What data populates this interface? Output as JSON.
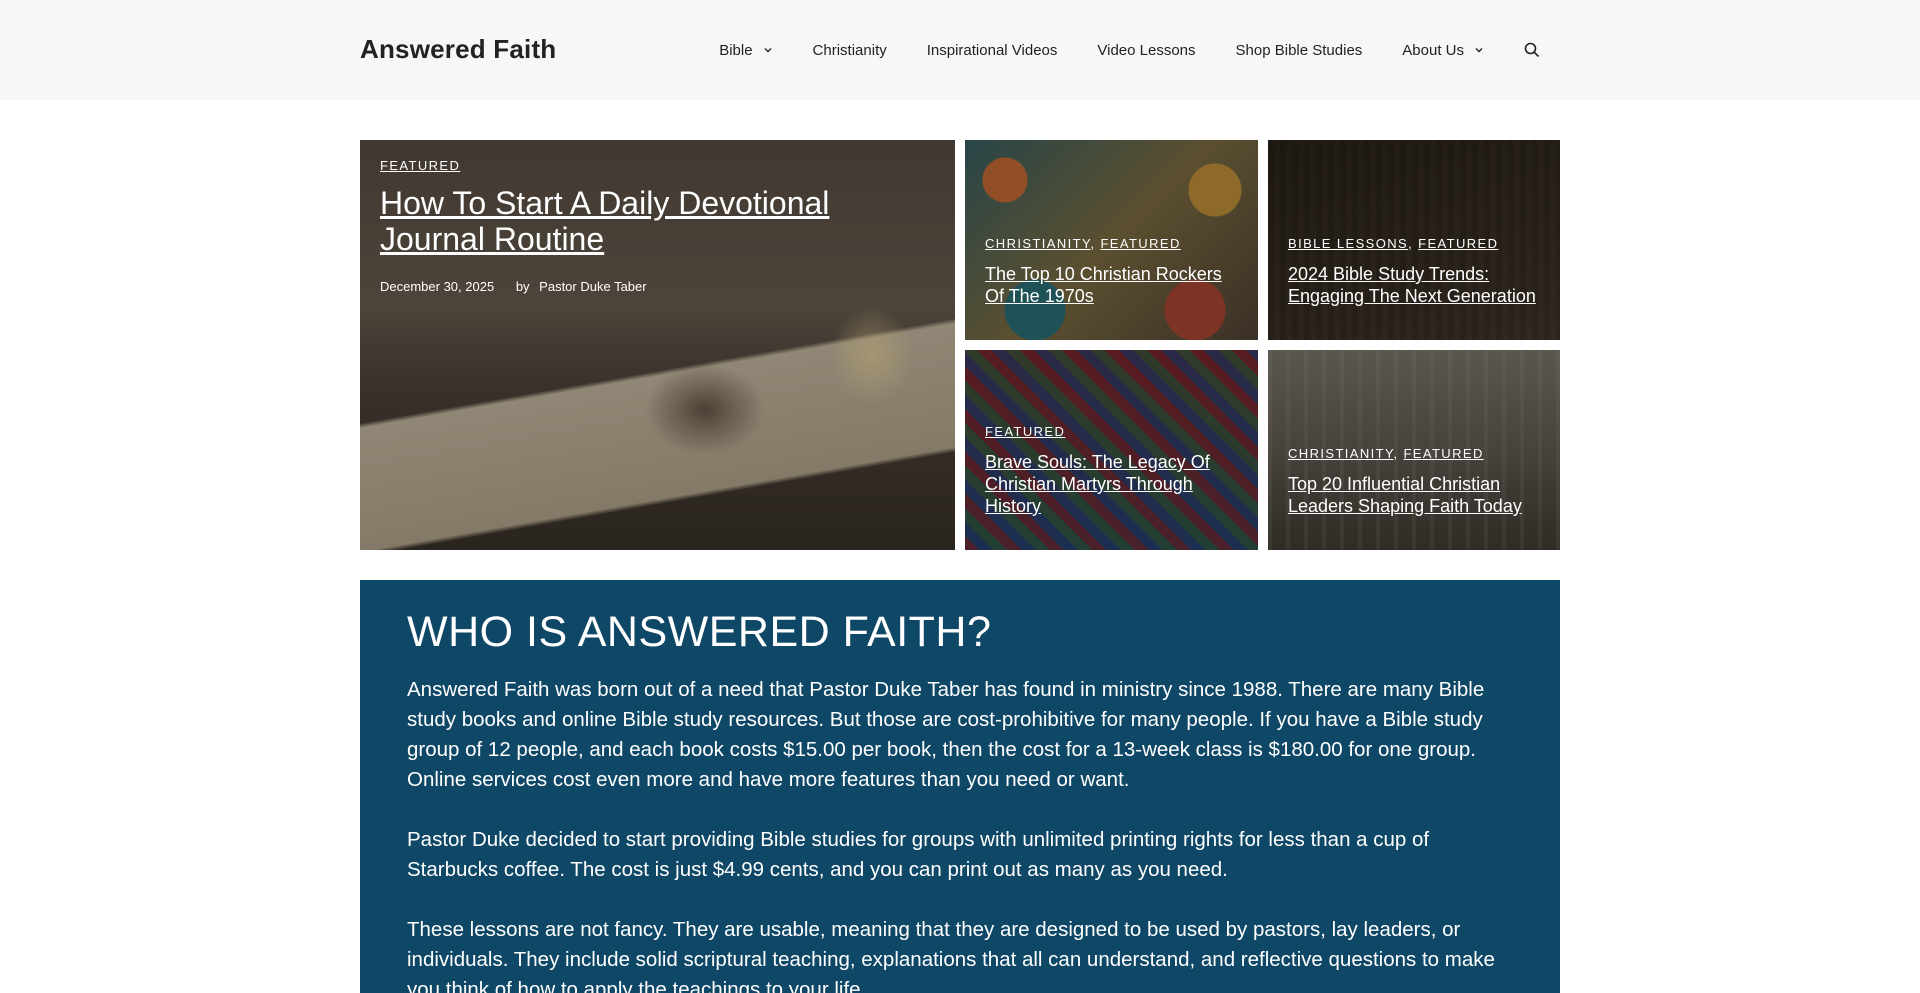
{
  "header": {
    "site_title": "Answered Faith",
    "nav": [
      {
        "label": "Bible",
        "has_dropdown": true
      },
      {
        "label": "Christianity",
        "has_dropdown": false
      },
      {
        "label": "Inspirational Videos",
        "has_dropdown": false
      },
      {
        "label": "Video Lessons",
        "has_dropdown": false
      },
      {
        "label": "Shop Bible Studies",
        "has_dropdown": false
      },
      {
        "label": "About Us",
        "has_dropdown": true
      }
    ],
    "search_icon": "search-icon"
  },
  "featured": {
    "main": {
      "categories": [
        "Featured"
      ],
      "title": "How To Start A Daily Devotional Journal Routine",
      "date": "December 30, 2025",
      "by": "by",
      "author": "Pastor Duke Taber"
    },
    "tiles": [
      {
        "categories": [
          "Christianity",
          "Featured"
        ],
        "title": "The Top 10 Christian Rockers Of The 1970s"
      },
      {
        "categories": [
          "Bible Lessons",
          "Featured"
        ],
        "title": "2024 Bible Study Trends: Engaging The Next Generation"
      },
      {
        "categories": [
          "Featured"
        ],
        "title": "Brave Souls: The Legacy Of Christian Martyrs Through History"
      },
      {
        "categories": [
          "Christianity",
          "Featured"
        ],
        "title": "Top 20 Influential Christian Leaders Shaping Faith Today"
      }
    ]
  },
  "about": {
    "heading": "WHO IS ANSWERED FAITH?",
    "paragraphs": [
      "Answered Faith was born out of a need that Pastor Duke Taber has found in ministry since 1988. There are many Bible study books and online Bible study resources. But those are cost-prohibitive for many people. If you have a Bible study group of 12 people, and each book costs $15.00 per book, then the cost for a 13-week class is $180.00 for one group. Online services cost even more and have more features than you need or want.",
      "Pastor Duke decided to start providing Bible studies for groups with unlimited printing rights for less than a cup of Starbucks coffee. The cost is just $4.99 cents, and you can print out as many as you need.",
      "These lessons are not fancy. They are usable, meaning that they are designed to be used by pastors, lay leaders, or individuals. They include solid scriptural teaching, explanations that all can understand, and reflective questions to make you think of how to apply the teachings to your life."
    ]
  },
  "colors": {
    "header_bg": "#f7f7f8",
    "about_bg": "#0f4766",
    "text": "#222222"
  }
}
